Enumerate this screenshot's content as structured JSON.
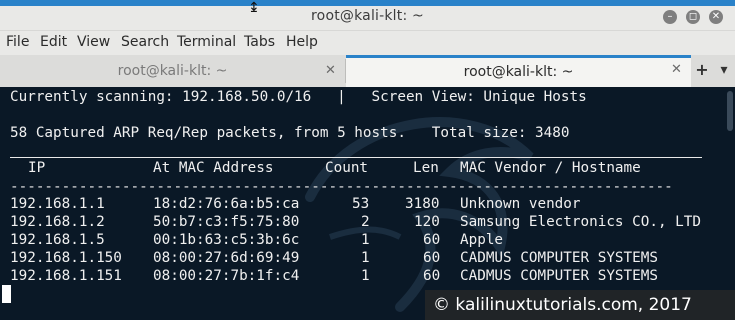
{
  "window": {
    "title": "root@kali-klt: ~",
    "controls": {
      "minimize": "–",
      "maximize": "◻",
      "close": "✕"
    }
  },
  "menu": [
    "File",
    "Edit",
    "View",
    "Search",
    "Terminal",
    "Tabs",
    "Help"
  ],
  "tabs": [
    {
      "label": "root@kali-klt: ~",
      "active": false,
      "close": "✕"
    },
    {
      "label": "root@kali-klt: ~",
      "active": true,
      "close": "✕"
    }
  ],
  "tabbar": {
    "new_tab": "+",
    "menu": "▾"
  },
  "terminal": {
    "status_line": "Currently scanning: 192.168.50.0/16   |   Screen View: Unique Hosts",
    "summary_line": "58 Captured ARP Req/Rep packets, from 5 hosts.   Total size: 3480",
    "headers": [
      "IP",
      "At MAC Address",
      "Count",
      "Len",
      "MAC Vendor / Hostname"
    ],
    "dashes": "-----------------------------------------------------------------------------",
    "rows": [
      {
        "ip": "192.168.1.1",
        "mac": "18:d2:76:6a:b5:ca",
        "count": "53",
        "len": "3180",
        "vendor": "Unknown vendor"
      },
      {
        "ip": "192.168.1.2",
        "mac": "50:b7:c3:f5:75:80",
        "count": "2",
        "len": "120",
        "vendor": "Samsung Electronics CO., LTD"
      },
      {
        "ip": "192.168.1.5",
        "mac": "00:1b:63:c5:3b:6c",
        "count": "1",
        "len": "60",
        "vendor": "Apple"
      },
      {
        "ip": "192.168.1.150",
        "mac": "08:00:27:6d:69:49",
        "count": "1",
        "len": "60",
        "vendor": "CADMUS COMPUTER SYSTEMS"
      },
      {
        "ip": "192.168.1.151",
        "mac": "08:00:27:7b:1f:c4",
        "count": "1",
        "len": "60",
        "vendor": "CADMUS COMPUTER SYSTEMS"
      }
    ]
  },
  "watermark": "© kalilinuxtutorials.com, 2017",
  "colors": {
    "accent": "#2a82c9",
    "terminal_bg": "#0a1826",
    "terminal_fg": "#f0f0f0"
  }
}
